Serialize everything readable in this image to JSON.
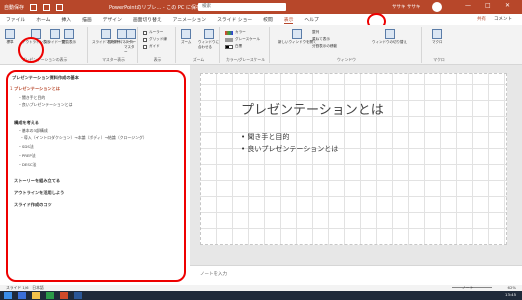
{
  "titlebar": {
    "autosave": "自動保存",
    "doc_title": "PowerPointのリブレ... - この PC に保存済み",
    "search_placeholder": "検索",
    "user": "ササキ ササキ",
    "minimize": "—",
    "maximize": "□",
    "close": "✕"
  },
  "tabs": [
    "ファイル",
    "ホーム",
    "挿入",
    "描画",
    "デザイン",
    "画面切り替え",
    "アニメーション",
    "スライド ショー",
    "校閲",
    "表示",
    "ヘルプ"
  ],
  "active_tab": "表示",
  "tabs_right": {
    "share": "共有",
    "comment": "コメント"
  },
  "ribbon": {
    "groups": [
      {
        "label": "プレゼンテーションの表示"
      },
      {
        "label": "マスター表示"
      },
      {
        "label": "表示"
      },
      {
        "label": "ズーム"
      },
      {
        "label": "カラー/グレースケール"
      },
      {
        "label": "ウィンドウ"
      },
      {
        "label": "マクロ"
      }
    ],
    "buttons": {
      "normal": "標準",
      "outline": "アウトライン表示",
      "sorter": "スライド一覧",
      "notes_page": "ノート",
      "reading": "閲覧表示",
      "slide_master": "スライドマスター",
      "handout_master": "配布資料マスター",
      "notes_master": "ノートマスター",
      "ruler": "ルーラー",
      "gridlines": "グリッド線",
      "guides": "ガイド",
      "notes": "ノート",
      "zoom": "ズーム",
      "fit": "ウィンドウに合わせる",
      "color": "カラー",
      "grayscale": "グレースケール",
      "bw": "白黒",
      "new_window": "新しいウィンドウを開く",
      "arrange": "整列",
      "cascade": "重ねて表示",
      "move_split": "分割表示の移動",
      "switch_windows": "ウィンドウの切り替え",
      "macro": "マクロ"
    }
  },
  "outline": {
    "header": "プレゼンテーション資料作成の基本",
    "items": [
      {
        "num": "1",
        "text": "プレゼンテーションとは",
        "level": 0
      },
      {
        "text": "・聞き手と目的",
        "level": 1
      },
      {
        "text": "・良いプレゼンテーションとは",
        "level": 1
      },
      {
        "text": "構成を考える",
        "level": 0
      },
      {
        "text": "・基本の3部構成",
        "level": 1
      },
      {
        "text": "・導入（イントロダクション）→本論（ボディ）→結論（クロージング）",
        "level": 2
      },
      {
        "text": "・SDS法",
        "level": 1
      },
      {
        "text": "・PREP法",
        "level": 1
      },
      {
        "text": "・DESC法",
        "level": 1
      },
      {
        "text": "ストーリーを組み立てる",
        "level": 0
      },
      {
        "text": "アウトラインを活用しよう",
        "level": 0
      },
      {
        "text": "スライド作成のコツ",
        "level": 0
      }
    ]
  },
  "slide": {
    "title": "プレゼンテーションとは",
    "bullets": [
      "• 聞き手と目的",
      "• 良いプレゼンテーションとは"
    ]
  },
  "notes_placeholder": "ノートを入力",
  "status": {
    "left": "スライド 1/6　日本語",
    "right": "ノート　　　　　　　　　62%"
  },
  "taskbar": {
    "time": "13:45"
  }
}
